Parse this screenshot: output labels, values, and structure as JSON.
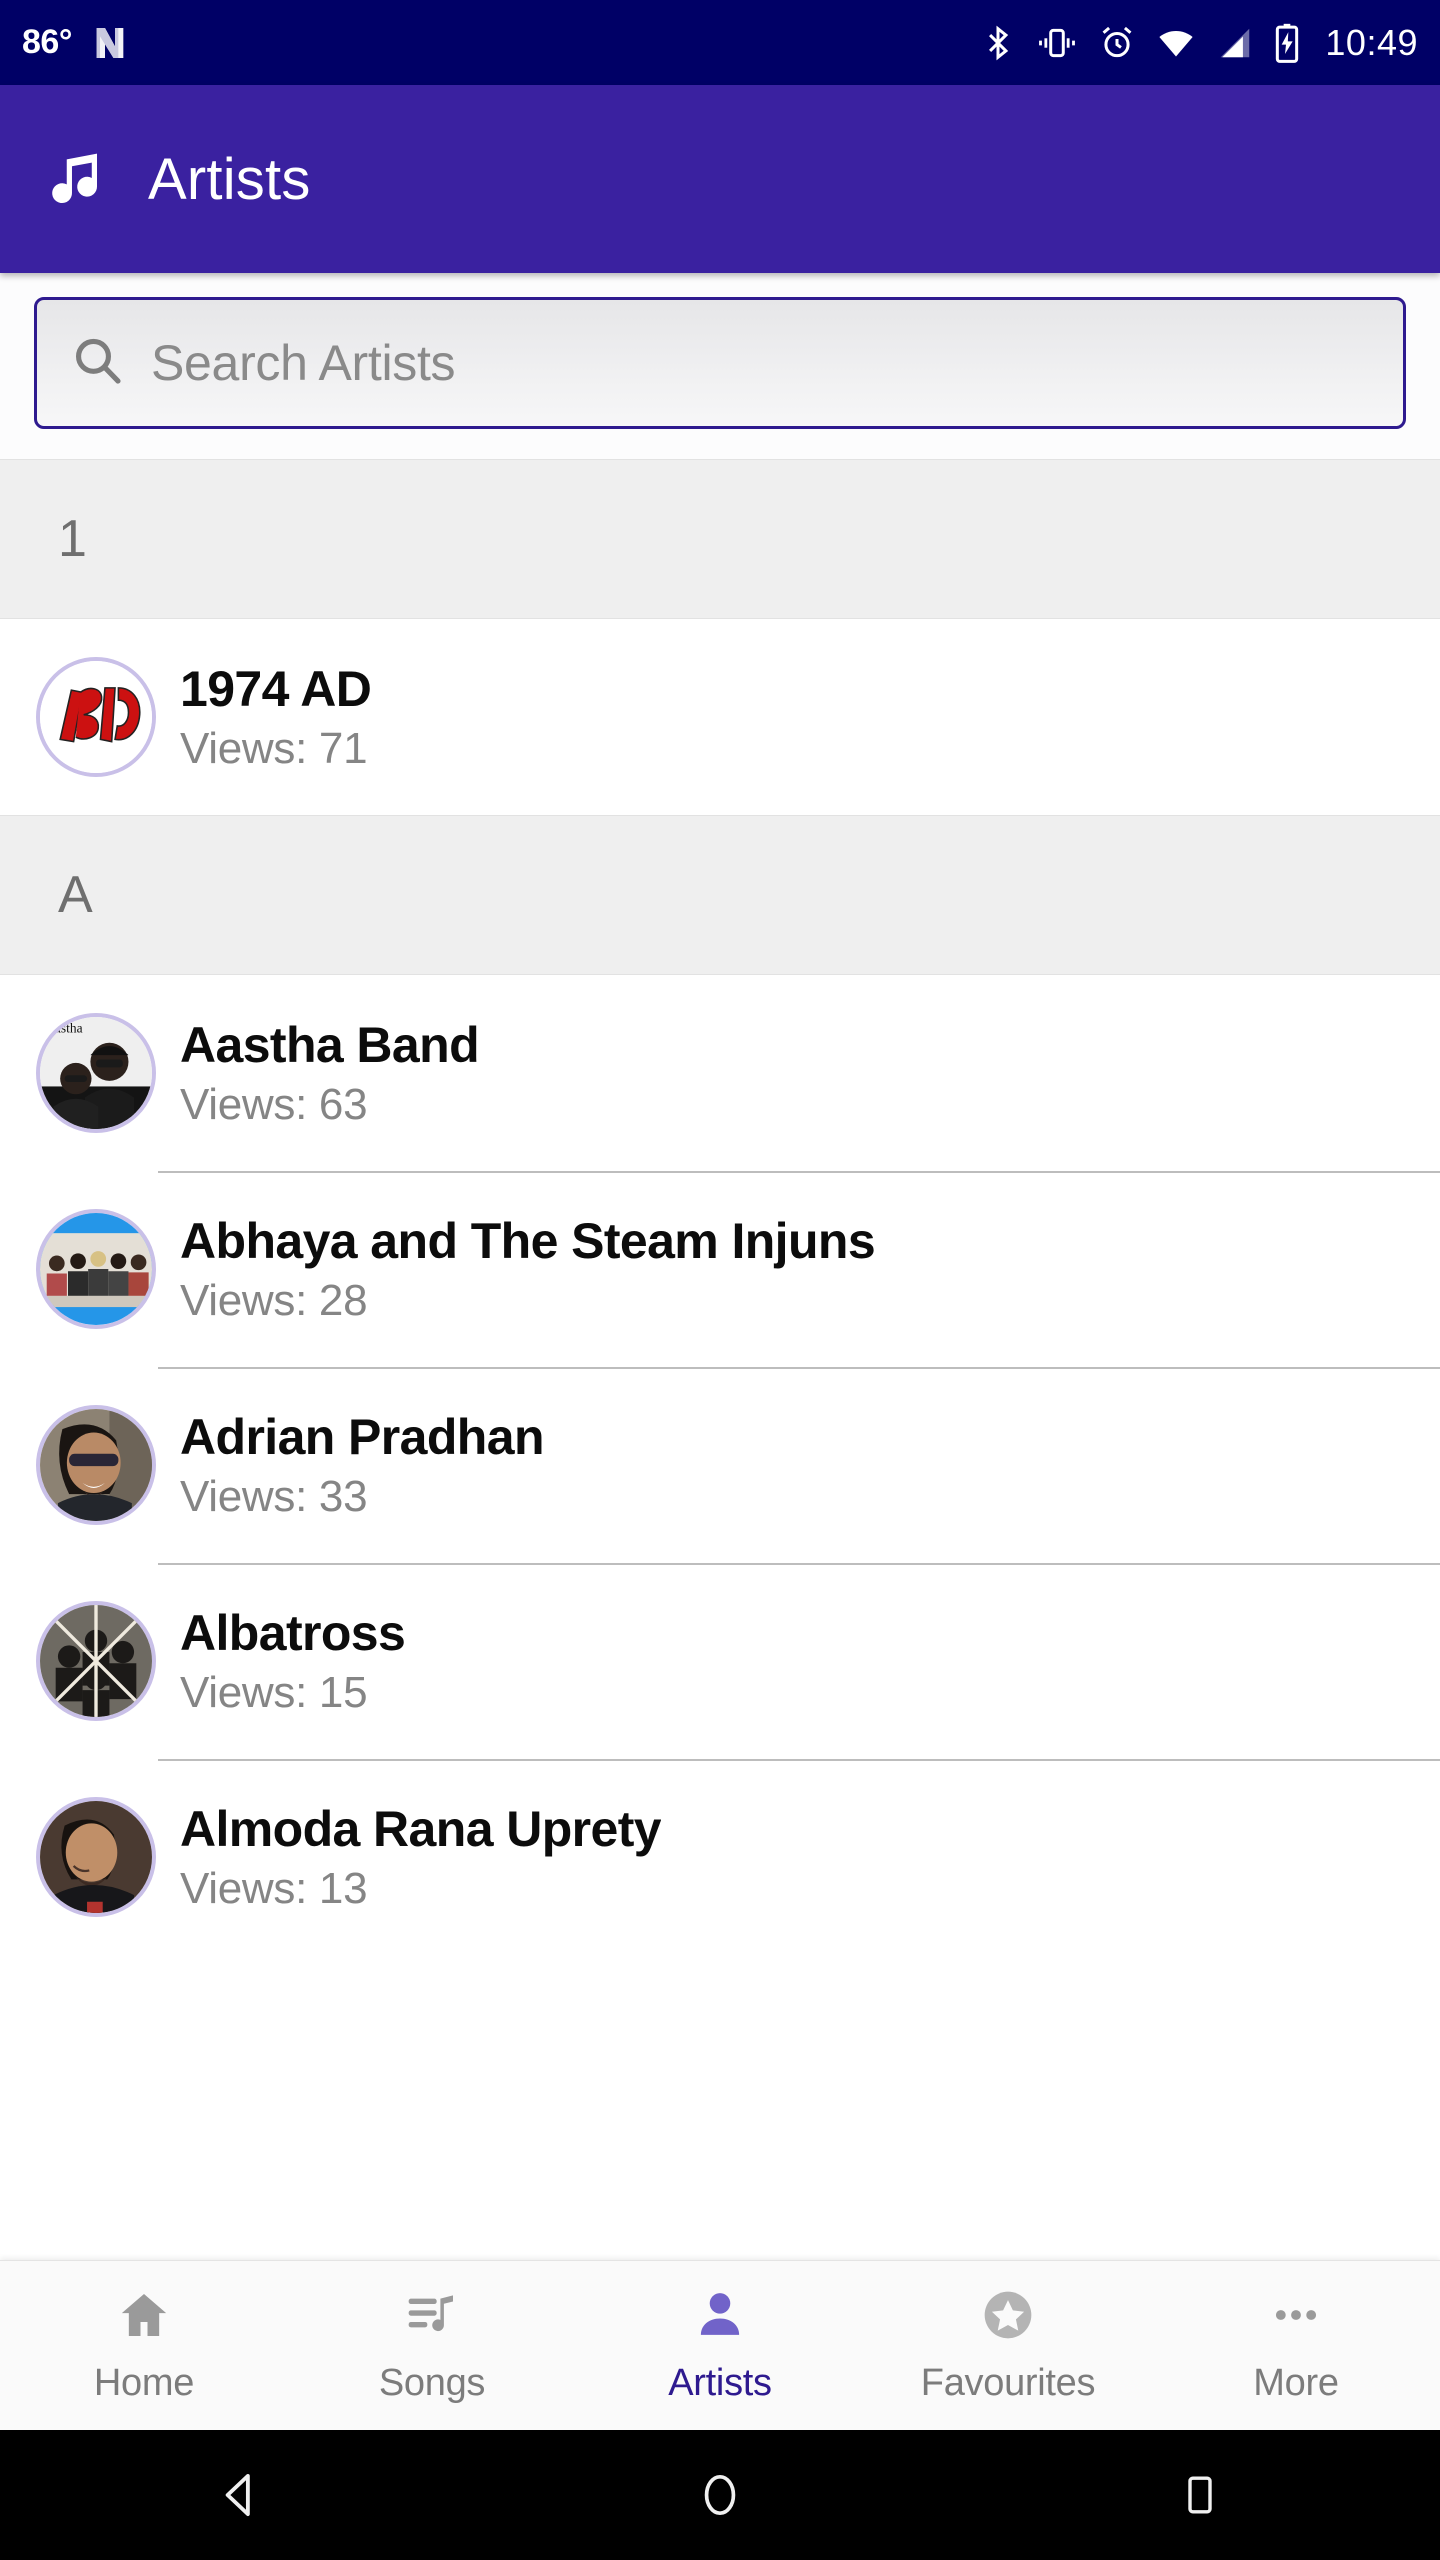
{
  "status_bar": {
    "temperature": "86°",
    "app_icon": "nougat-n-icon",
    "icons": [
      "bluetooth-icon",
      "vibrate-icon",
      "alarm-icon",
      "wifi-icon",
      "cell-signal-icon",
      "battery-charging-icon"
    ],
    "time": "10:49",
    "background_color": "#000066"
  },
  "app_bar": {
    "icon": "music-note-icon",
    "title": "Artists",
    "background_color": "#3A21A0",
    "text_color": "#FFFFFF"
  },
  "search": {
    "icon": "search-icon",
    "placeholder": "Search Artists",
    "value": "",
    "border_color": "#2E1A8F"
  },
  "sections": [
    {
      "header": "1",
      "items": [
        {
          "name": "1974 AD",
          "views_label": "Views: 71",
          "avatar": "logo-1974ad-avatar",
          "divider": false
        }
      ]
    },
    {
      "header": "A",
      "items": [
        {
          "name": "Aastha Band",
          "views_label": "Views: 63",
          "avatar": "aastha-band-avatar",
          "divider": false
        },
        {
          "name": "Abhaya and The Steam Injuns",
          "views_label": "Views: 28",
          "avatar": "abhaya-band-avatar",
          "divider": true
        },
        {
          "name": "Adrian Pradhan",
          "views_label": "Views: 33",
          "avatar": "adrian-pradhan-avatar",
          "divider": true
        },
        {
          "name": "Albatross",
          "views_label": "Views: 15",
          "avatar": "albatross-band-avatar",
          "divider": true
        },
        {
          "name": "Almoda Rana Uprety",
          "views_label": "Views: 13",
          "avatar": "almoda-rana-uprety-avatar",
          "divider": true
        }
      ]
    }
  ],
  "bottom_nav": {
    "active_color": "#2E1A8F",
    "inactive_color": "#7C7C7C",
    "items": [
      {
        "label": "Home",
        "icon": "home-icon",
        "active": false
      },
      {
        "label": "Songs",
        "icon": "playlist-music-icon",
        "active": false
      },
      {
        "label": "Artists",
        "icon": "person-icon",
        "active": true
      },
      {
        "label": "Favourites",
        "icon": "star-circle-icon",
        "active": false
      },
      {
        "label": "More",
        "icon": "more-horizontal-icon",
        "active": false
      }
    ]
  },
  "system_nav": {
    "back": "back-triangle-icon",
    "home": "home-circle-icon",
    "recents": "recents-square-icon"
  }
}
